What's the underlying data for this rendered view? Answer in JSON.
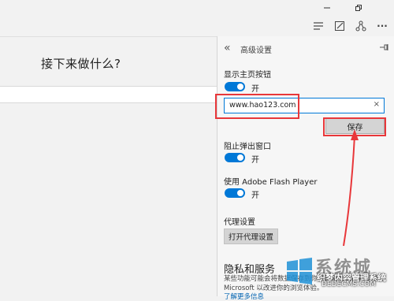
{
  "window": {
    "minimize_icon": "minimize-icon",
    "restore_icon": "restore-icon"
  },
  "toolbar": {
    "icons": [
      "hub-icon",
      "web-note-icon",
      "share-icon",
      "more-icon"
    ],
    "more_label": "···"
  },
  "content": {
    "heading": "接下来做什么?"
  },
  "panel": {
    "back_glyph": "«",
    "title": "高级设置",
    "pin_glyph": "⊣",
    "home_button": {
      "label": "显示主页按钮",
      "toggle_state": "开",
      "url_value": "www.hao123.com",
      "clear_glyph": "×",
      "save_label": "保存"
    },
    "popup_block": {
      "label": "阻止弹出窗口",
      "toggle_state": "开"
    },
    "flash": {
      "label": "使用 Adobe Flash Player",
      "toggle_state": "开"
    },
    "proxy": {
      "label": "代理设置",
      "button_label": "打开代理设置"
    },
    "privacy": {
      "heading": "隐私和服务",
      "text": "某些功能可能会将数据保存到你的设备上或将其发送给 Microsoft 以改进你的浏览体验。",
      "link": "了解更多信息"
    }
  },
  "colors": {
    "accent": "#0078d7",
    "highlight": "#e8373a",
    "panel_bg": "#f6f6f6"
  },
  "watermark": {
    "big": "系统城",
    "cn": "织梦内容管理系统",
    "en": "DEDECMS.COM"
  }
}
